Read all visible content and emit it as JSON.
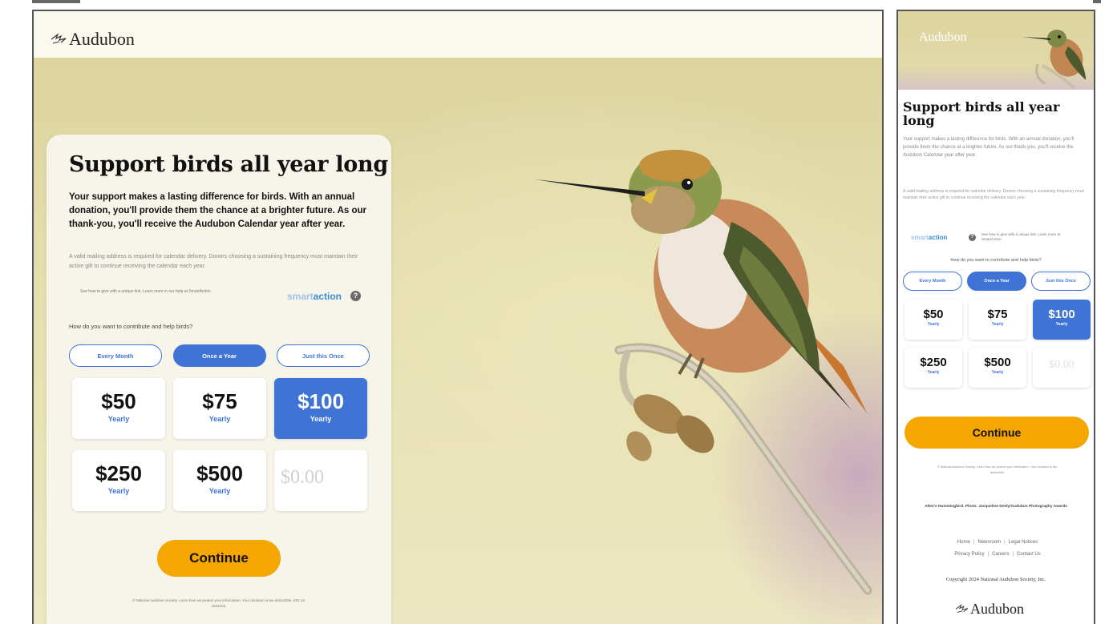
{
  "brand": {
    "name": "Audubon"
  },
  "desktop": {
    "title": "Support birds all year long",
    "intro": "Your support makes a lasting difference for birds. With an annual donation, you'll provide them the chance at a brighter future. As our thank-you, you'll receive the Audubon Calendar year after year.",
    "note": "A valid mailing address is required for calendar delivery. Donors choosing a sustaining frequency must maintain their active gift to continue receiving the calendar each year.",
    "smart_note": "See how to give with a unique link. Learn more in our help at SmartAction.",
    "smart_logo_prefix": "smart",
    "smart_logo_suffix": "action",
    "help": "?",
    "question": "How do you want to contribute and help birds?",
    "frequencies": [
      {
        "label": "Every Month",
        "active": false
      },
      {
        "label": "Once a Year",
        "active": true
      },
      {
        "label": "Just this Once",
        "active": false
      }
    ],
    "amounts": [
      {
        "value": "$50",
        "period": "Yearly",
        "active": false
      },
      {
        "value": "$75",
        "period": "Yearly",
        "active": false
      },
      {
        "value": "$100",
        "period": "Yearly",
        "active": true
      },
      {
        "value": "$250",
        "period": "Yearly",
        "active": false
      },
      {
        "value": "$500",
        "period": "Yearly",
        "active": false
      }
    ],
    "custom_placeholder": "$0.00",
    "continue_label": "Continue",
    "footer": "© National Audubon Society. Learn how we protect your information. Your donation is tax-deductible. EIN 13-1624102."
  },
  "mobile": {
    "title": "Support birds all year long",
    "intro": "Your support makes a lasting difference for birds. With an annual donation, you'll provide them the chance at a brighter future. As our thank-you, you'll receive the Audubon Calendar year after year.",
    "note": "A valid mailing address is required for calendar delivery. Donors choosing a sustaining frequency must maintain their active gift to continue receiving the calendar each year.",
    "smart_logo_prefix": "smart",
    "smart_logo_suffix": "action",
    "help": "?",
    "smart_note": "See how to give with a unique link. Learn more at SmartAction.",
    "question": "How do you want to contribute and help birds?",
    "frequencies": [
      {
        "label": "Every Month",
        "active": false
      },
      {
        "label": "Once a Year",
        "active": true
      },
      {
        "label": "Just this Once",
        "active": false
      }
    ],
    "amounts": [
      {
        "value": "$50",
        "period": "Yearly",
        "active": false
      },
      {
        "value": "$75",
        "period": "Yearly",
        "active": false
      },
      {
        "value": "$100",
        "period": "Yearly",
        "active": true
      },
      {
        "value": "$250",
        "period": "Yearly",
        "active": false
      },
      {
        "value": "$500",
        "period": "Yearly",
        "active": false
      }
    ],
    "custom_placeholder": "$0.00",
    "continue_label": "Continue",
    "footer_note": "© National Audubon Society. Learn how we protect your information. Your donation is tax-deductible.",
    "photo_credit": "Allen's Hummingbird. Photo: Jacqueline Deely/Audubon Photography Awards",
    "links": [
      "Home",
      "Newsroom",
      "Legal Notices",
      "Privacy Policy",
      "Careers",
      "Contact Us"
    ],
    "copyright": "Copyright 2024 National Audubon Society, Inc."
  },
  "colors": {
    "accent_blue": "#3f73d6",
    "cta_orange": "#f5a600",
    "card_bg": "#f7f4ea"
  },
  "icons": {
    "logo_bird": "bird-logo-icon",
    "help": "help-icon"
  }
}
